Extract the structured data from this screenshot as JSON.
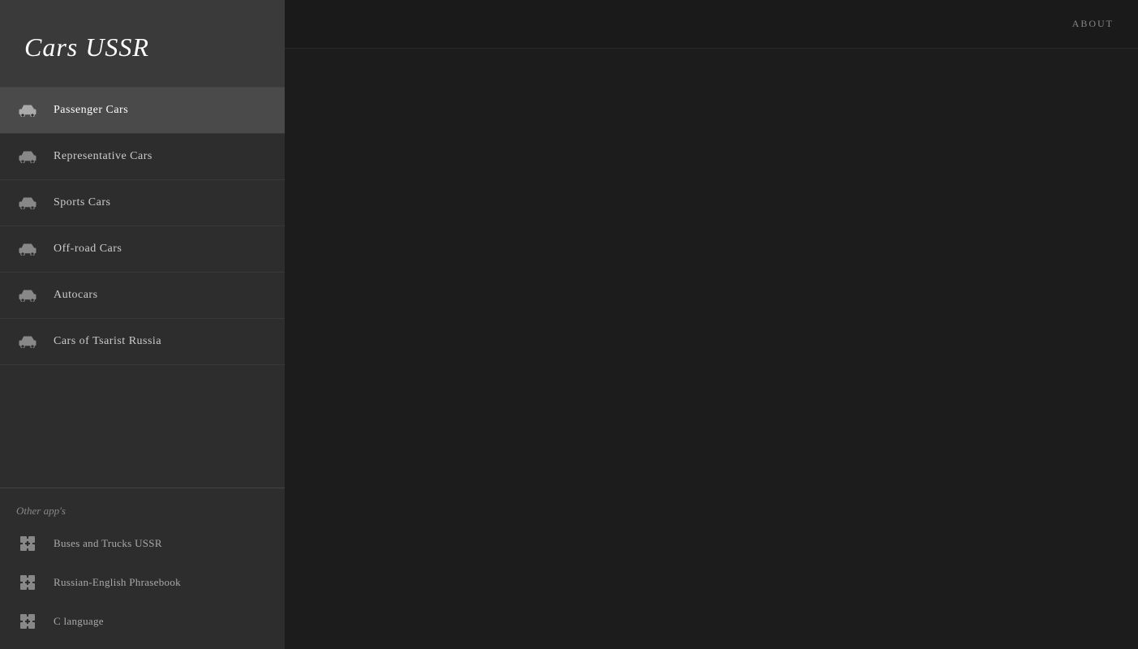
{
  "app": {
    "title": "Cars USSR"
  },
  "header": {
    "about_label": "ABOUT"
  },
  "nav_items": [
    {
      "id": "passenger",
      "label": "Passenger Cars",
      "active": true
    },
    {
      "id": "representative",
      "label": "Representative Cars",
      "active": false
    },
    {
      "id": "sports",
      "label": "Sports Cars",
      "active": false
    },
    {
      "id": "offroad",
      "label": "Off-road Cars",
      "active": false
    },
    {
      "id": "autocars",
      "label": "Autocars",
      "active": false
    },
    {
      "id": "tsarist",
      "label": "Cars of Tsarist Russia",
      "active": false
    }
  ],
  "other_apps_section": {
    "label": "Other app's",
    "items": [
      {
        "id": "buses-trucks",
        "label": "Buses and Trucks USSR"
      },
      {
        "id": "phrasebook",
        "label": "Russian-English Phrasebook"
      },
      {
        "id": "c-language",
        "label": "C language"
      }
    ]
  }
}
